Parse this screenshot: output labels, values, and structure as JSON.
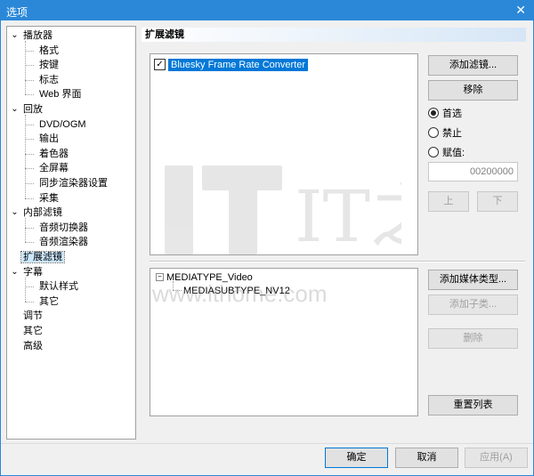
{
  "window": {
    "title": "选项",
    "close_glyph": "✕"
  },
  "tree": {
    "items": [
      {
        "label": "播放器",
        "level": 0,
        "expanded": true
      },
      {
        "label": "格式",
        "level": 1
      },
      {
        "label": "按键",
        "level": 1
      },
      {
        "label": "标志",
        "level": 1
      },
      {
        "label": "Web 界面",
        "level": 1
      },
      {
        "label": "回放",
        "level": 0,
        "expanded": true
      },
      {
        "label": "DVD/OGM",
        "level": 1
      },
      {
        "label": "输出",
        "level": 1
      },
      {
        "label": "着色器",
        "level": 1
      },
      {
        "label": "全屏幕",
        "level": 1
      },
      {
        "label": "同步渲染器设置",
        "level": 1
      },
      {
        "label": "采集",
        "level": 1
      },
      {
        "label": "内部滤镜",
        "level": 0,
        "expanded": true
      },
      {
        "label": "音频切换器",
        "level": 1
      },
      {
        "label": "音频渲染器",
        "level": 1
      },
      {
        "label": "扩展滤镜",
        "level": 0,
        "selected": true
      },
      {
        "label": "字幕",
        "level": 0,
        "expanded": true
      },
      {
        "label": "默认样式",
        "level": 1
      },
      {
        "label": "其它",
        "level": 1
      },
      {
        "label": "调节",
        "level": 0
      },
      {
        "label": "其它",
        "level": 0
      },
      {
        "label": "高级",
        "level": 0
      }
    ]
  },
  "panel": {
    "header": "扩展滤镜",
    "filters": [
      {
        "label": "Bluesky Frame Rate Converter",
        "checked": true
      }
    ],
    "buttons": {
      "add_filter": "添加滤镜...",
      "remove": "移除",
      "up": "上",
      "down": "下",
      "add_media_type": "添加媒体类型...",
      "add_subtype": "添加子类...",
      "delete": "删除",
      "reset_list": "重置列表"
    },
    "radios": {
      "prefer": "首选",
      "block": "禁止",
      "merit": "赋值:"
    },
    "merit_value": "00200000",
    "media_types": {
      "root": "MEDIATYPE_Video",
      "child": "MEDIASUBTYPE_NV12"
    }
  },
  "footer": {
    "ok": "确定",
    "cancel": "取消",
    "apply": "应用(A)"
  },
  "watermark": {
    "logo": "IT之家",
    "url": "www.ithome.com"
  },
  "colors": {
    "titlebar": "#2b88d8",
    "selection": "#0078d7"
  }
}
